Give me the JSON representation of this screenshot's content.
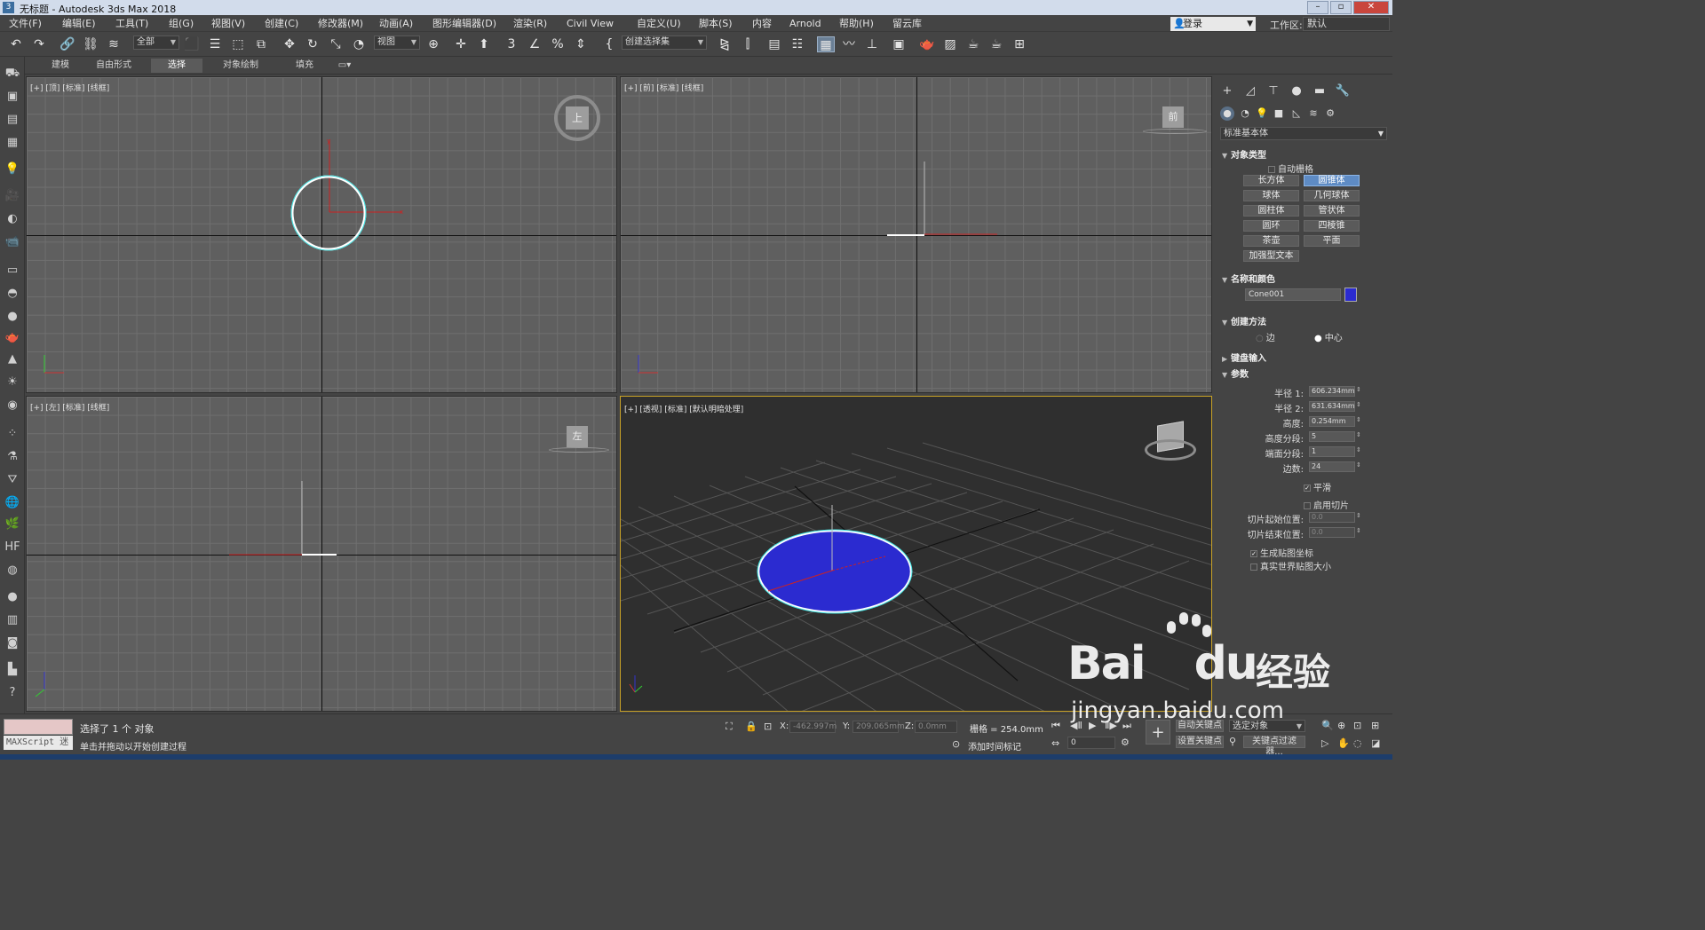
{
  "window": {
    "title": "无标题 - Autodesk 3ds Max 2018",
    "icon": "3"
  },
  "menu": [
    "文件(F)",
    "编辑(E)",
    "工具(T)",
    "组(G)",
    "视图(V)",
    "创建(C)",
    "修改器(M)",
    "动画(A)",
    "图形编辑器(D)",
    "渲染(R)",
    "Civil View",
    "自定义(U)",
    "脚本(S)",
    "内容",
    "Arnold",
    "帮助(H)",
    "留云库"
  ],
  "login": "登录",
  "workspace": {
    "label": "工作区:",
    "value": "默认"
  },
  "toolbar": {
    "filter": "全部",
    "ref_coord": "视图",
    "selection_set": "创建选择集",
    "snap_label": "3"
  },
  "ribbon_tabs": [
    "建模",
    "自由形式",
    "选择",
    "对象绘制",
    "填充"
  ],
  "viewports": {
    "top": {
      "label": "[+] [顶] [标准] [线框]",
      "cube": "上"
    },
    "front": {
      "label": "[+] [前] [标准] [线框]",
      "cube": "前"
    },
    "left": {
      "label": "[+] [左] [标准] [线框]",
      "cube": "左"
    },
    "perspective": {
      "label": "[+] [透视] [标准] [默认明暗处理]"
    }
  },
  "command_panel": {
    "category": "标准基本体",
    "object_type": {
      "title": "对象类型",
      "autogrid": "自动栅格",
      "buttons": [
        "长方体",
        "圆锥体",
        "球体",
        "几何球体",
        "圆柱体",
        "管状体",
        "圆环",
        "四棱锥",
        "茶壶",
        "平面",
        "加强型文本"
      ],
      "selected": "圆锥体"
    },
    "name_color": {
      "title": "名称和颜色",
      "name": "Cone001",
      "color": "#2b2bd0"
    },
    "creation_method": {
      "title": "创建方法",
      "opt1": "边",
      "opt2": "中心"
    },
    "keyboard": {
      "title": "键盘输入"
    },
    "params": {
      "title": "参数",
      "radius1": {
        "label": "半径 1:",
        "value": "606.234mm"
      },
      "radius2": {
        "label": "半径 2:",
        "value": "631.634mm"
      },
      "height": {
        "label": "高度:",
        "value": "0.254mm"
      },
      "height_segs": {
        "label": "高度分段:",
        "value": "5"
      },
      "cap_segs": {
        "label": "端面分段:",
        "value": "1"
      },
      "sides": {
        "label": "边数:",
        "value": "24"
      },
      "smooth": "平滑",
      "slice_on": "启用切片",
      "slice_from": {
        "label": "切片起始位置:",
        "value": "0.0"
      },
      "slice_to": {
        "label": "切片结束位置:",
        "value": "0.0"
      },
      "gen_map": "生成贴图坐标",
      "real_world": "真实世界贴图大小"
    }
  },
  "status": {
    "maxscript": "MAXScript 迷",
    "line1": "选择了 1 个 对象",
    "line2": "单击并拖动以开始创建过程",
    "x_label": "X:",
    "x": "-462.997m",
    "y_label": "Y:",
    "y": "209.065mm",
    "z_label": "Z:",
    "z": "0.0mm",
    "grid": "栅格 = 254.0mm",
    "add_time_tag": "添加时间标记",
    "auto_key": "自动关键点",
    "selected_obj": "选定对象",
    "set_key": "设置关键点",
    "key_filter": "关键点过滤器...",
    "frame": "0"
  },
  "watermark": {
    "brand": "Bai",
    "brand2": "du",
    "cn": "经验",
    "url": "jingyan.baidu.com"
  },
  "colors": {
    "accent": "#5e8bc4",
    "object": "#2b2bd0",
    "selection": "#ffffff",
    "active_border": "#c9a227"
  }
}
